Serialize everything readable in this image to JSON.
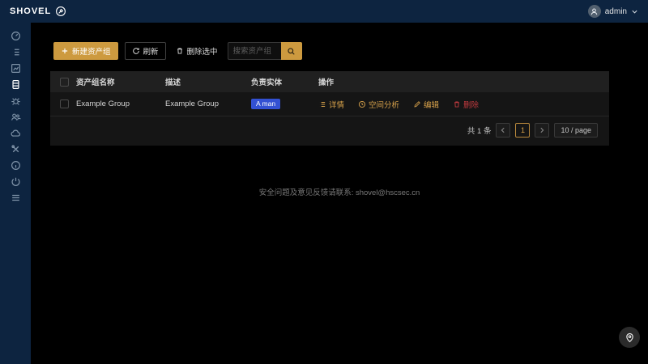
{
  "colors": {
    "navy": "#0d2440",
    "gold": "#cd9a3f",
    "gold_link": "#d8a24b",
    "danger": "#c23a3f",
    "badge_blue": "#3351d3",
    "background": "#000000",
    "panel": "#151515"
  },
  "navbar": {
    "brand": "SHOVEL",
    "user_name": "admin"
  },
  "sidebar": {
    "items": [
      {
        "name": "dashboard"
      },
      {
        "name": "task-list"
      },
      {
        "name": "chart"
      },
      {
        "name": "asset-database",
        "active": true
      },
      {
        "name": "spider"
      },
      {
        "name": "team"
      },
      {
        "name": "cloud"
      },
      {
        "name": "tools"
      },
      {
        "name": "info"
      },
      {
        "name": "power"
      },
      {
        "name": "menu"
      }
    ]
  },
  "toolbar": {
    "new_group_label": "新建资产组",
    "refresh_label": "刷新",
    "delete_selected_label": "删除选中",
    "search_placeholder": "搜索资产组"
  },
  "table": {
    "headers": {
      "name": "资产组名称",
      "description": "描述",
      "entity": "负责实体",
      "actions": "操作"
    },
    "rows": [
      {
        "name": "Example Group",
        "description": "Example Group",
        "entity_badge": "A man",
        "actions": {
          "details": "详情",
          "space_analysis": "空间分析",
          "edit": "编辑",
          "delete": "删除"
        }
      }
    ]
  },
  "pagination": {
    "total": "共 1 条",
    "current_page": "1",
    "page_size": "10 / page"
  },
  "footer": {
    "contact_text": "安全问题及意见反馈请联系: shovel@hscsec.cn"
  }
}
